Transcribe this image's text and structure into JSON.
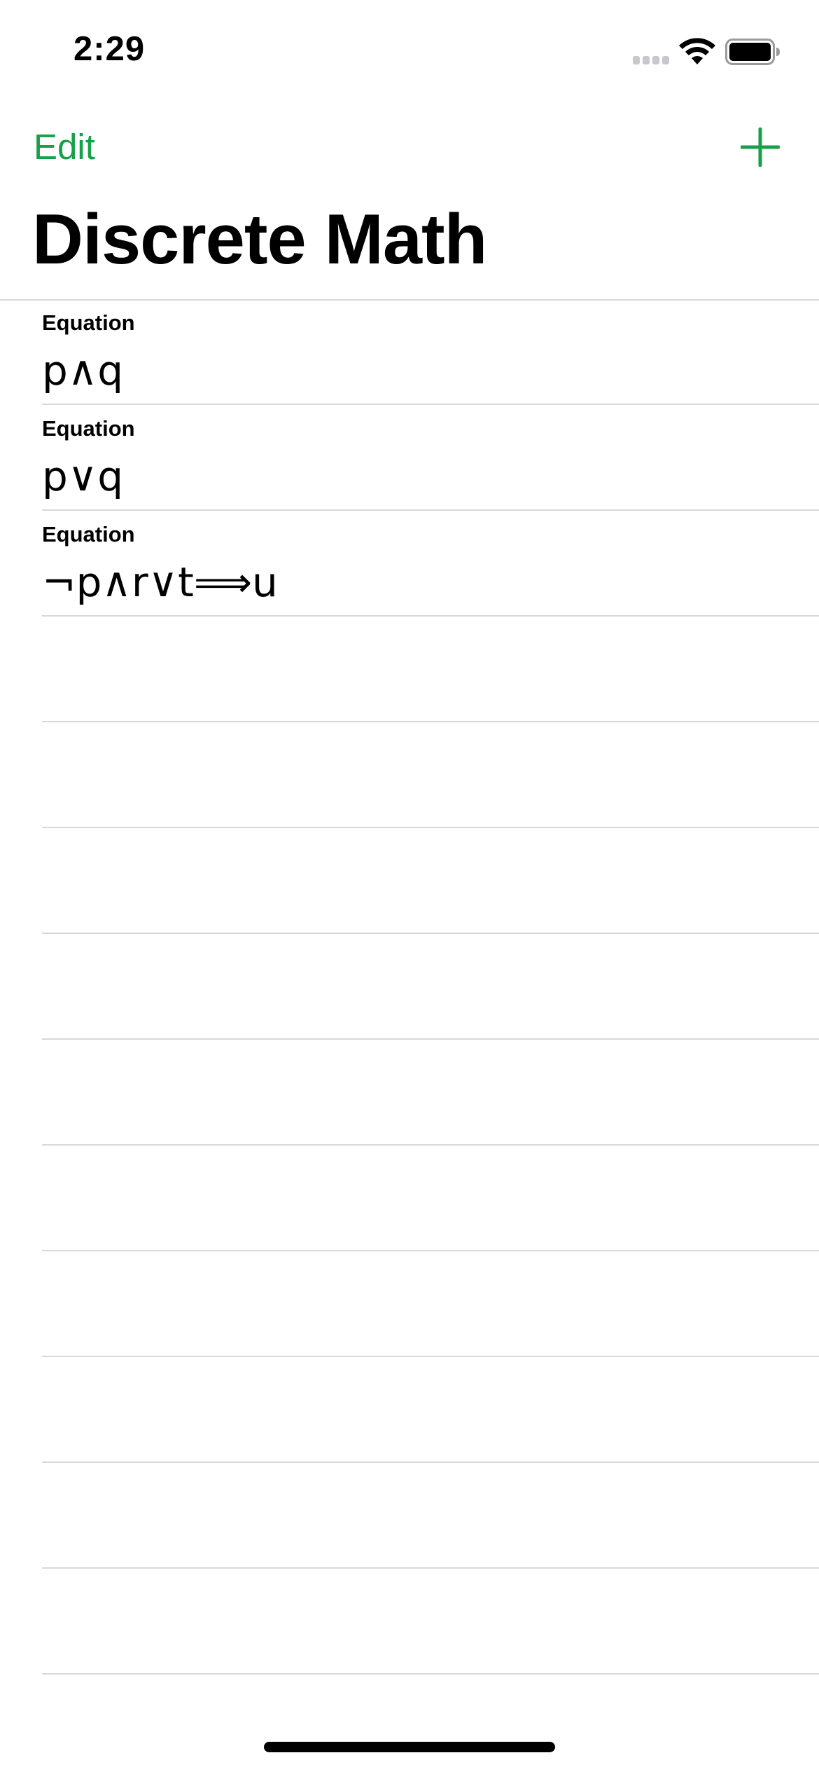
{
  "status_bar": {
    "time": "2:29",
    "icons": [
      "signal-icon",
      "wifi-icon",
      "battery-icon"
    ]
  },
  "nav": {
    "edit_label": "Edit",
    "add_icon": "plus-icon",
    "accent_color": "#16a04a"
  },
  "title": "Discrete Math",
  "list": {
    "rows": [
      {
        "label": "Equation",
        "equation": "p∧q"
      },
      {
        "label": "Equation",
        "equation": "p∨q"
      },
      {
        "label": "Equation",
        "equation": "¬p∧r∨t⟹u"
      }
    ]
  }
}
